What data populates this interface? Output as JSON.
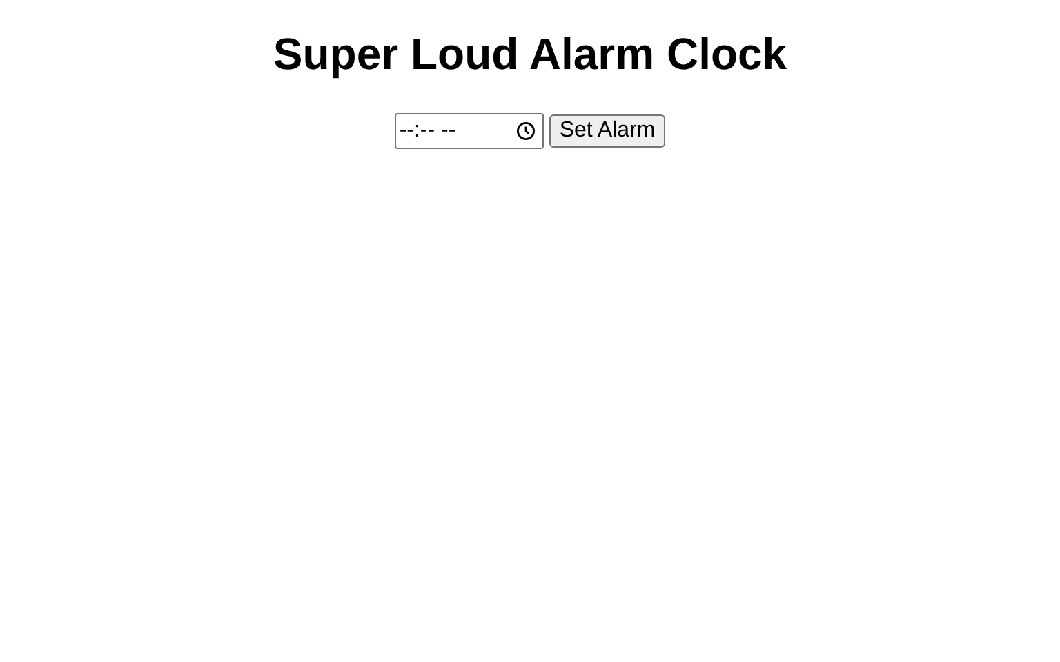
{
  "title": "Super Loud Alarm Clock",
  "time_field": {
    "placeholder": "--:-- --"
  },
  "button": "Set Alarm"
}
